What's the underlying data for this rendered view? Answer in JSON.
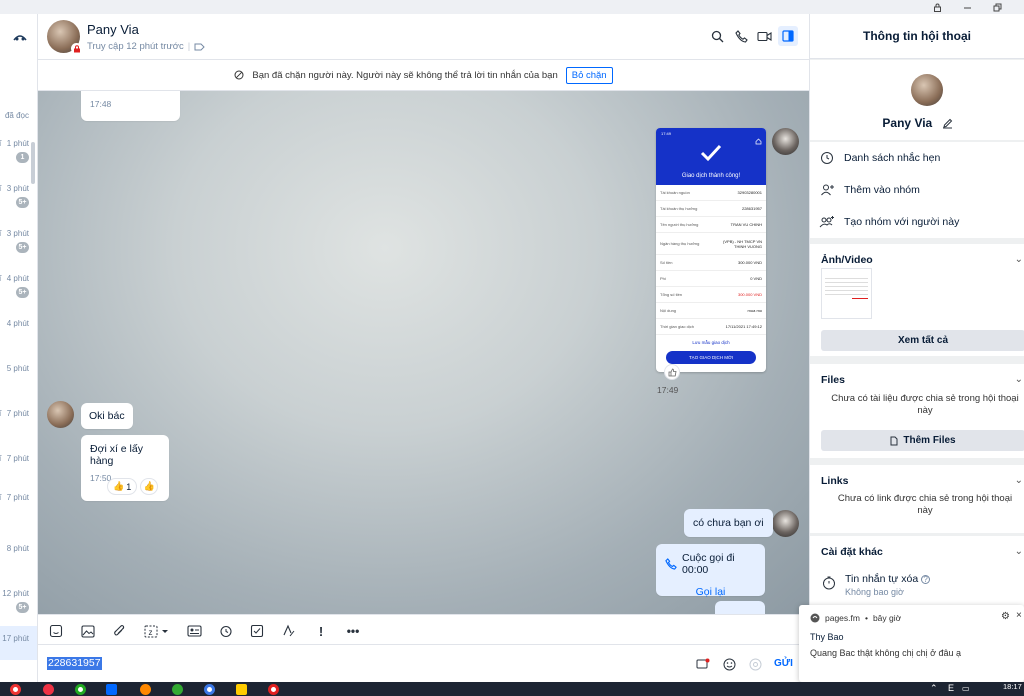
{
  "header": {
    "contact_name": "Pany Via",
    "status": "Truy cập 12 phút trước"
  },
  "block_notice": {
    "text": "Bạn đã chặn người này. Người này sẽ không thể trả lời tin nhắn của bạn",
    "unblock_label": "Bỏ chặn"
  },
  "left_list": {
    "read_label": "đã đọc",
    "items": [
      {
        "time": "1 phút",
        "badge": "1"
      },
      {
        "time": "3 phút",
        "badge": "5+"
      },
      {
        "time": "3 phút",
        "badge": "5+"
      },
      {
        "time": "4 phút",
        "badge": "5+"
      },
      {
        "time": "4 phút",
        "badge": ""
      },
      {
        "time": "5 phút",
        "badge": ""
      },
      {
        "time": "7 phút",
        "badge": ""
      },
      {
        "time": "7 phút",
        "badge": ""
      },
      {
        "time": "7 phút",
        "badge": ""
      },
      {
        "time": "8 phút",
        "badge": ""
      },
      {
        "time": "12 phút",
        "badge": "5+"
      },
      {
        "time": "17 phút",
        "badge": ""
      }
    ]
  },
  "messages": {
    "m0_time": "17:48",
    "receipt": {
      "status_time": "17:49",
      "title": "Giao dịch thành công!",
      "rows": [
        {
          "k": "Tài khoản nguồn",
          "v": "32903280001"
        },
        {
          "k": "Tài khoản thụ hưởng",
          "v": "228631957"
        },
        {
          "k": "Tên người thụ hưởng",
          "v": "TRAN VU CHINH"
        },
        {
          "k": "Ngân hàng thụ hưởng",
          "v": "(VPB) - NH TMCP VN THINH VUONG"
        },
        {
          "k": "Số tiền",
          "v": "300.000 VND"
        },
        {
          "k": "Phí",
          "v": "0 VND"
        },
        {
          "k": "Tổng số tiền",
          "v": "300.000 VND"
        },
        {
          "k": "Nội dung",
          "v": "mua mo"
        },
        {
          "k": "Thời gian giao dịch",
          "v": "17/11/2021 17:49:12"
        }
      ],
      "save_link": "Lưu mẫu giao dịch",
      "new_button": "TẠO GIAO DỊCH MỚI",
      "time": "17:49"
    },
    "m1_text": "Oki bác",
    "m2_text": "Đợi xí e lấy hàng",
    "m2_time": "17:50",
    "m2_react_count": "1",
    "m3_text": "có chưa bạn ơi",
    "call_text": "Cuộc gọi đi 00:00",
    "call_back": "Gọi lại"
  },
  "input": {
    "value": "228631957",
    "send_label": "GỬI"
  },
  "right_panel": {
    "title": "Thông tin hội thoại",
    "name": "Pany Via",
    "actions": [
      "Danh sách nhắc hẹn",
      "Thêm vào nhóm",
      "Tạo nhóm với người này"
    ],
    "media_title": "Ảnh/Video",
    "see_all": "Xem tất cả",
    "files_title": "Files",
    "files_empty": "Chưa có tài liệu được chia sẻ trong hội thoại này",
    "add_files": "Thêm Files",
    "links_title": "Links",
    "links_empty": "Chưa có link được chia sẻ trong hội thoại này",
    "settings_title": "Cài đặt khác",
    "self_delete": "Tin nhắn tự xóa",
    "self_delete_sub": "Không bao giờ"
  },
  "toast": {
    "source": "pages.fm",
    "when": "bây giờ",
    "sender": "Thy Bao",
    "message": "Quang Bac  thật không chị chị ở đâu ạ"
  },
  "taskbar": {
    "clock": "18:17",
    "lang": "E"
  }
}
